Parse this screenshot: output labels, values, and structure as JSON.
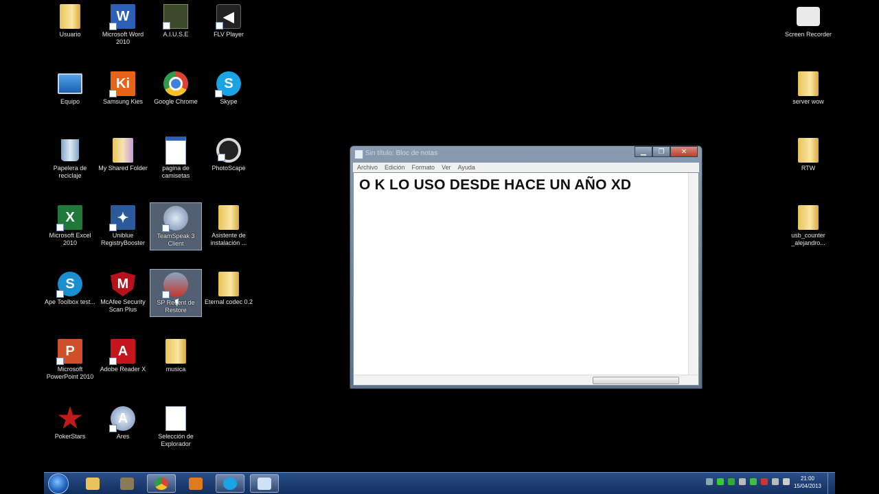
{
  "desktop_icons": [
    {
      "label": "Usuario"
    },
    {
      "label": "Microsoft Word 2010"
    },
    {
      "label": "A.I.U.S.E"
    },
    {
      "label": "FLV Player"
    },
    {
      "label": "Screen Recorder"
    },
    {
      "label": "Equipo"
    },
    {
      "label": "Samsung Kies"
    },
    {
      "label": "Google Chrome"
    },
    {
      "label": "Skype"
    },
    {
      "label": "server wow"
    },
    {
      "label": "Papelera de reciclaje"
    },
    {
      "label": "My Shared Folder"
    },
    {
      "label": "pagina de camisetas"
    },
    {
      "label": "PhotoScape"
    },
    {
      "label": "RTW"
    },
    {
      "label": "Microsoft Excel 2010"
    },
    {
      "label": "Uniblue RegistryBooster"
    },
    {
      "label": "TeamSpeak 3 Client"
    },
    {
      "label": "Asistente de instalación ..."
    },
    {
      "label": "usb_counter _alejandro..."
    },
    {
      "label": "Ape Toolbox test..."
    },
    {
      "label": "McAfee Security Scan Plus"
    },
    {
      "label": "SP Recent de Restore"
    },
    {
      "label": "Eternal codec 0.2"
    },
    {
      "label": "Microsoft PowerPoint 2010"
    },
    {
      "label": "Adobe Reader X"
    },
    {
      "label": "musica"
    },
    {
      "label": "PokerStars"
    },
    {
      "label": "Ares"
    },
    {
      "label": "Selección de Explorador"
    }
  ],
  "notepad": {
    "title": "Sin título: Bloc de notas",
    "menu": [
      "Archivo",
      "Edición",
      "Formato",
      "Ver",
      "Ayuda"
    ],
    "content": "O K LO USO DESDE HACE UN AÑO XD",
    "minimize": "▁",
    "maximize": "❐",
    "close": "✕"
  },
  "taskbar": {
    "time": "21:00",
    "date": "15/04/2013"
  }
}
